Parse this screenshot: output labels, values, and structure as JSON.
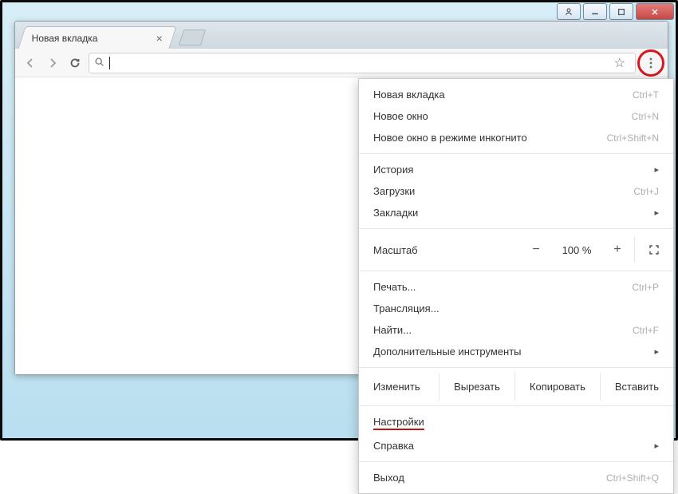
{
  "window": {
    "controls": {
      "profile": "profile",
      "minimize": "minimize",
      "maximize": "maximize",
      "close": "close"
    }
  },
  "tab": {
    "title": "Новая вкладка"
  },
  "omnibox": {
    "value": "",
    "placeholder": ""
  },
  "zoom": {
    "label": "Масштаб",
    "value": "100 %",
    "minus": "−",
    "plus": "+"
  },
  "edit": {
    "label": "Изменить",
    "cut": "Вырезать",
    "copy": "Копировать",
    "paste": "Вставить"
  },
  "menu": {
    "new_tab": {
      "label": "Новая вкладка",
      "shortcut": "Ctrl+T"
    },
    "new_window": {
      "label": "Новое окно",
      "shortcut": "Ctrl+N"
    },
    "incognito": {
      "label": "Новое окно в режиме инкогнито",
      "shortcut": "Ctrl+Shift+N"
    },
    "history": {
      "label": "История"
    },
    "downloads": {
      "label": "Загрузки",
      "shortcut": "Ctrl+J"
    },
    "bookmarks": {
      "label": "Закладки"
    },
    "print": {
      "label": "Печать...",
      "shortcut": "Ctrl+P"
    },
    "cast": {
      "label": "Трансляция..."
    },
    "find": {
      "label": "Найти...",
      "shortcut": "Ctrl+F"
    },
    "more_tools": {
      "label": "Дополнительные инструменты"
    },
    "settings": {
      "label": "Настройки"
    },
    "help": {
      "label": "Справка"
    },
    "exit": {
      "label": "Выход",
      "shortcut": "Ctrl+Shift+Q"
    }
  }
}
